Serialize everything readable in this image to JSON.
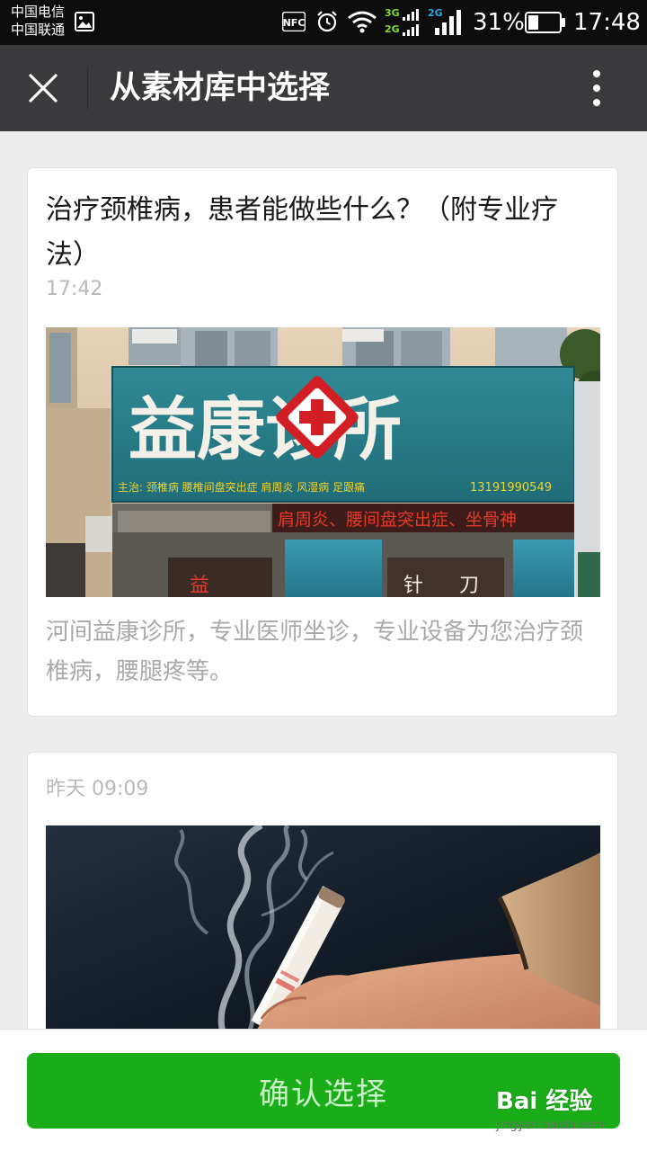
{
  "status_bar": {
    "carrier_1": "中国电信",
    "carrier_2": "中国联通",
    "network_1": "3G",
    "network_2": "2G",
    "network_3": "2G",
    "nfc": "NFC",
    "battery": "31%",
    "time": "17:48"
  },
  "titlebar": {
    "title": "从素材库中选择",
    "close_icon": "close-icon",
    "more_icon": "more-vertical-icon"
  },
  "articles": [
    {
      "title": "治疗颈椎病，患者能做些什么？（附专业疗法）",
      "time": "17:42",
      "cover": {
        "sign_text": "益康诊所",
        "sign_subtext": "主治: 颈椎病 腰椎间盘突出症 肩周炎 风湿病 足跟痛",
        "phone": "13191990549",
        "banner_text": "肩周炎、腰间盘突出症、坐骨神",
        "door_1": "益",
        "door_2": "针",
        "door_3": "刀"
      },
      "description": "河间益康诊所，专业医师坐诊，专业设备为您治疗颈椎病，腰腿疼等。"
    },
    {
      "title": "",
      "time": "昨天 09:09",
      "cover": {
        "subject": "moxa-stick-smoke-image"
      },
      "description": ""
    }
  ],
  "bottom": {
    "confirm_label": "确认选择"
  },
  "watermark": {
    "logo": "Bai 经验",
    "url": "jingyan.baidu.com"
  },
  "colors": {
    "status_bar_bg": "#0d0d0d",
    "titlebar_bg": "#3a3a3d",
    "page_bg": "#ededed",
    "primary_green": "#1aad19",
    "timestamp_gray": "#b8b8b8",
    "description_gray": "#a9a9a9"
  }
}
